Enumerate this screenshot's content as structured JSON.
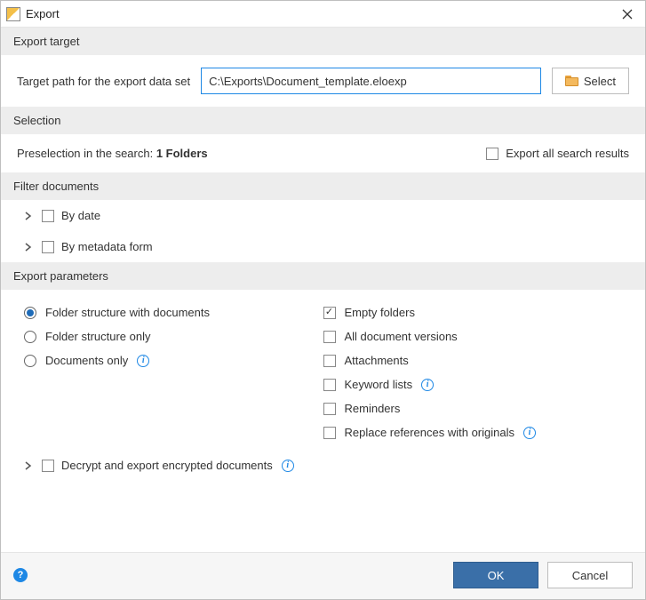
{
  "titlebar": {
    "title": "Export"
  },
  "sections": {
    "export_target": "Export target",
    "selection": "Selection",
    "filter_documents": "Filter documents",
    "export_parameters": "Export parameters"
  },
  "target": {
    "label": "Target path for the export data set",
    "path": "C:\\Exports\\Document_template.eloexp",
    "select_label": "Select"
  },
  "selection": {
    "preselection_prefix": "Preselection in the search: ",
    "preselection_value": "1 Folders",
    "export_all_label": "Export all search results"
  },
  "filters": {
    "by_date": "By date",
    "by_metadata": "By metadata form"
  },
  "params": {
    "radios": {
      "with_docs": "Folder structure with documents",
      "structure_only": "Folder structure only",
      "docs_only": "Documents only"
    },
    "checks": {
      "empty_folders": "Empty folders",
      "all_versions": "All document versions",
      "attachments": "Attachments",
      "keyword_lists": "Keyword lists",
      "reminders": "Reminders",
      "replace_refs": "Replace references with originals"
    },
    "decrypt": "Decrypt and export encrypted documents"
  },
  "footer": {
    "ok": "OK",
    "cancel": "Cancel"
  }
}
